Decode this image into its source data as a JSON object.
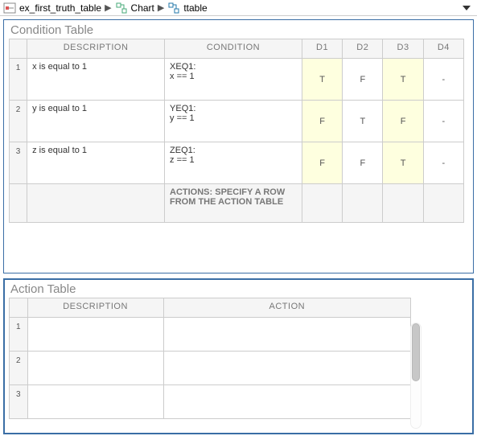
{
  "breadcrumb": {
    "items": [
      {
        "label": "ex_first_truth_table",
        "icon": "model"
      },
      {
        "label": "Chart",
        "icon": "chart"
      },
      {
        "label": "ttable",
        "icon": "ttable"
      }
    ]
  },
  "condition_panel": {
    "title": "Condition Table",
    "headers": {
      "desc": "DESCRIPTION",
      "cond": "CONDITION",
      "d1": "D1",
      "d2": "D2",
      "d3": "D3",
      "d4": "D4"
    },
    "rows": [
      {
        "num": "1",
        "desc": "x is equal to 1",
        "cond": "XEQ1:\nx == 1",
        "d": [
          "T",
          "F",
          "T",
          "-"
        ]
      },
      {
        "num": "2",
        "desc": "y is equal to 1",
        "cond": "YEQ1:\ny == 1",
        "d": [
          "F",
          "T",
          "F",
          "-"
        ]
      },
      {
        "num": "3",
        "desc": "z is equal to 1",
        "cond": "ZEQ1:\nz == 1",
        "d": [
          "F",
          "F",
          "T",
          "-"
        ]
      }
    ],
    "actions_label": "ACTIONS: SPECIFY A ROW FROM THE ACTION TABLE",
    "actions_d": [
      "",
      "",
      "",
      ""
    ],
    "highlight_cols": [
      0,
      2
    ]
  },
  "action_panel": {
    "title": "Action Table",
    "headers": {
      "desc": "DESCRIPTION",
      "act": "ACTION"
    },
    "rows": [
      {
        "num": "1",
        "desc": "",
        "act": ""
      },
      {
        "num": "2",
        "desc": "",
        "act": ""
      },
      {
        "num": "3",
        "desc": "",
        "act": ""
      }
    ]
  }
}
